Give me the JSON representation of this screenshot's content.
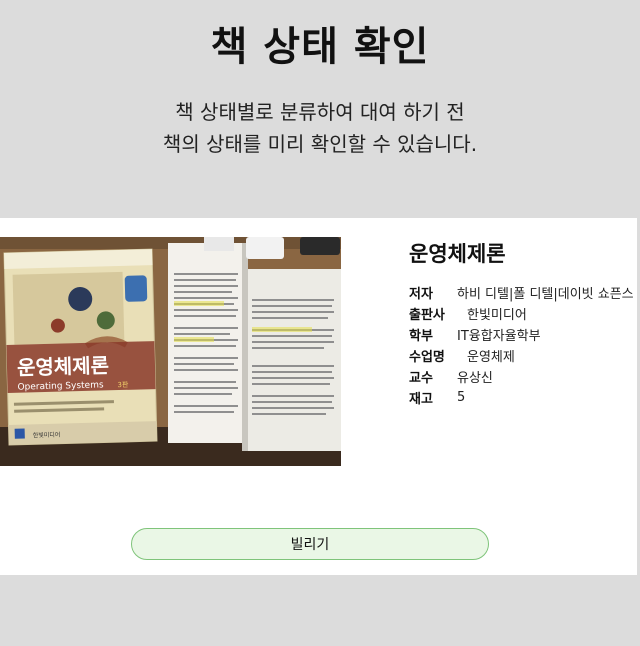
{
  "header": {
    "title": "책 상태 확인",
    "subtitle_line1": "책 상태별로 분류하여 대여 하기 전",
    "subtitle_line2": "책의 상태를 미리 확인할 수 있습니다."
  },
  "book": {
    "name": "운영체제론",
    "cover_title": "운영체제론",
    "cover_subtitle": "Operating Systems",
    "cover_edition": "3판",
    "cover_publisher": "한빛미디어",
    "details": [
      {
        "key": "저자",
        "value": "하비 디텔|폴 디텔|데이빗 쇼픈스"
      },
      {
        "key": "출판사",
        "value": "한빛미디어"
      },
      {
        "key": "학부",
        "value": "IT융합자율학부"
      },
      {
        "key": "수업명",
        "value": "운영체제"
      },
      {
        "key": "교수",
        "value": "유상신"
      },
      {
        "key": "재고",
        "value": "5"
      }
    ]
  },
  "actions": {
    "borrow_label": "빌리기"
  },
  "colors": {
    "page_bg": "#dcdcdc",
    "button_bg": "#eaf7e6",
    "button_border": "#7fc47a"
  }
}
